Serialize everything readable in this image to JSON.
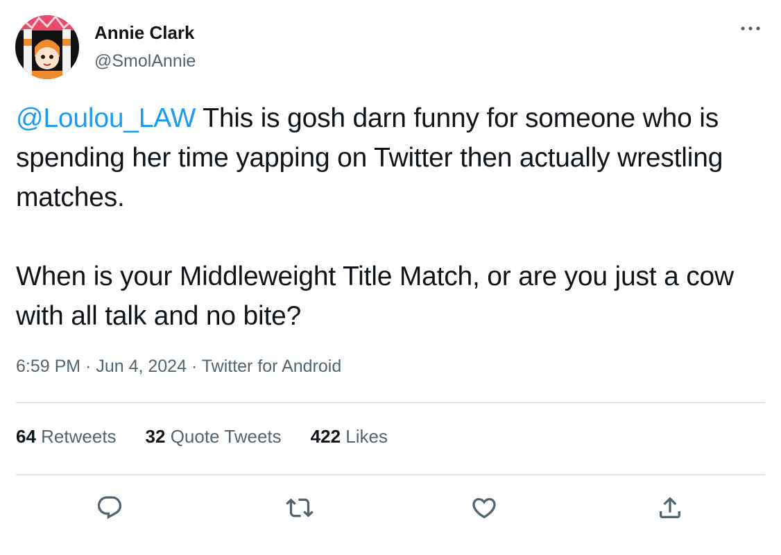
{
  "user": {
    "display_name": "Annie Clark",
    "handle": "@SmolAnnie"
  },
  "tweet": {
    "mention": "@Loulou_LAW",
    "paragraph1_rest": " This is gosh darn funny for someone who is spending her time yapping on Twitter then actually wrestling matches.",
    "paragraph2": "When is your Middleweight Title Match, or are you just a cow with all talk and no bite?",
    "time": "6:59 PM",
    "separator": " · ",
    "date": "Jun 4, 2024",
    "source": "Twitter for Android"
  },
  "stats": {
    "retweets_count": "64",
    "retweets_label": "Retweets",
    "quotes_count": "32",
    "quotes_label": "Quote Tweets",
    "likes_count": "422",
    "likes_label": "Likes"
  },
  "colors": {
    "text": "#0f1419",
    "secondary": "#536471",
    "link": "#1d9bf0",
    "divider": "#cfd9de"
  },
  "icons": {
    "more": "more-dots-icon",
    "reply": "reply-icon",
    "retweet": "retweet-icon",
    "like": "heart-icon",
    "share": "share-icon"
  }
}
